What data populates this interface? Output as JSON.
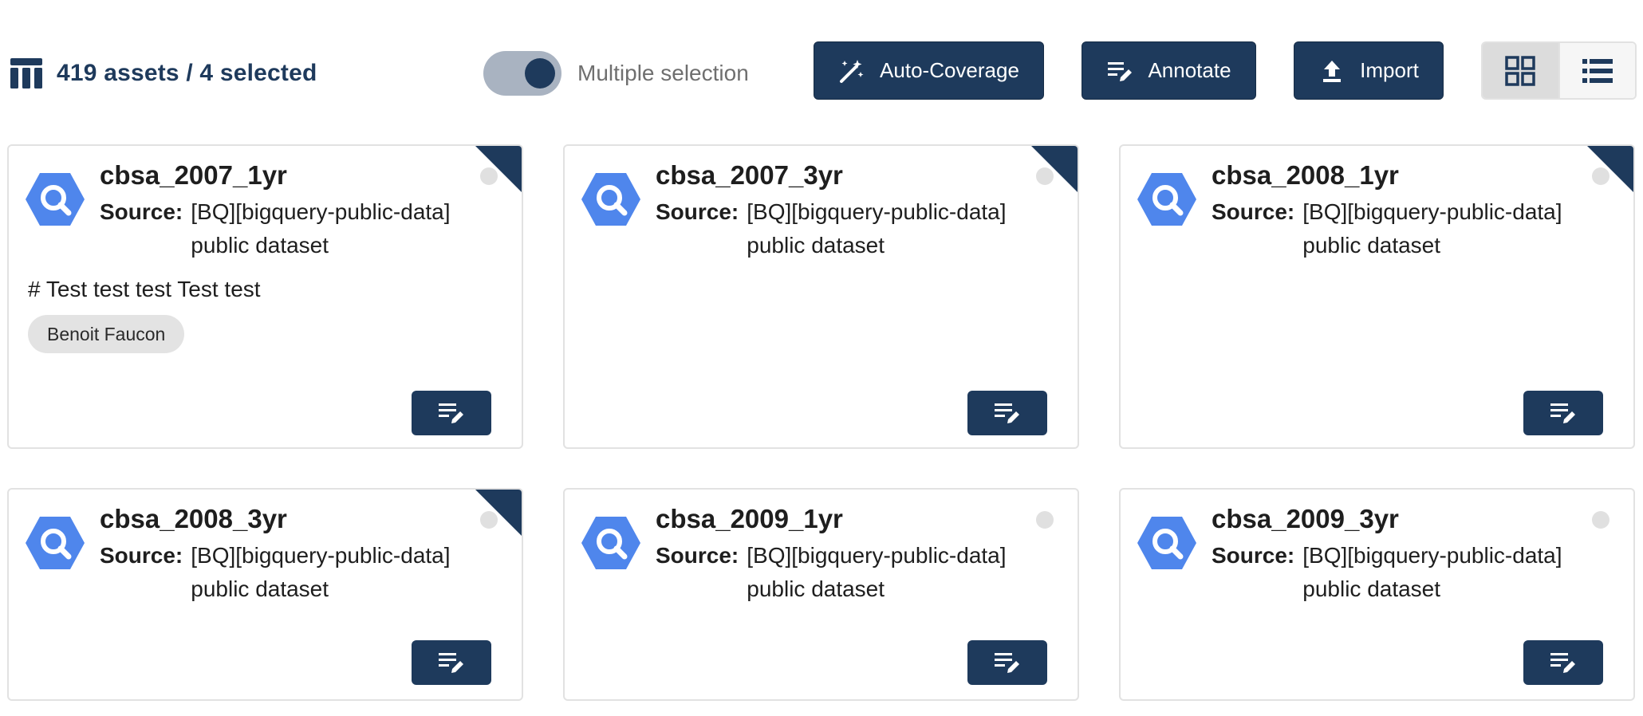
{
  "toolbar": {
    "summary": "419 assets / 4 selected",
    "multiple_selection": {
      "label": "Multiple selection",
      "enabled": true
    },
    "buttons": {
      "auto_coverage": "Auto-Coverage",
      "annotate": "Annotate",
      "import": "Import"
    },
    "view_mode": "grid"
  },
  "colors": {
    "primary": "#1e3a5c",
    "bigquery_blue": "#4f86ec",
    "tag_bg": "#e3e3e3",
    "border": "#e2e2e2"
  },
  "cards": [
    {
      "title": "cbsa_2007_1yr",
      "source_label": "Source:",
      "source_value": "[BQ][bigquery-public-data] public dataset",
      "selected": true,
      "description": "# Test test test Test test",
      "tag": "Benoit Faucon"
    },
    {
      "title": "cbsa_2007_3yr",
      "source_label": "Source:",
      "source_value": "[BQ][bigquery-public-data] public dataset",
      "selected": true
    },
    {
      "title": "cbsa_2008_1yr",
      "source_label": "Source:",
      "source_value": "[BQ][bigquery-public-data] public dataset",
      "selected": true
    },
    {
      "title": "cbsa_2008_3yr",
      "source_label": "Source:",
      "source_value": "[BQ][bigquery-public-data] public dataset",
      "selected": true
    },
    {
      "title": "cbsa_2009_1yr",
      "source_label": "Source:",
      "source_value": "[BQ][bigquery-public-data] public dataset",
      "selected": false
    },
    {
      "title": "cbsa_2009_3yr",
      "source_label": "Source:",
      "source_value": "[BQ][bigquery-public-data] public dataset",
      "selected": false
    }
  ]
}
